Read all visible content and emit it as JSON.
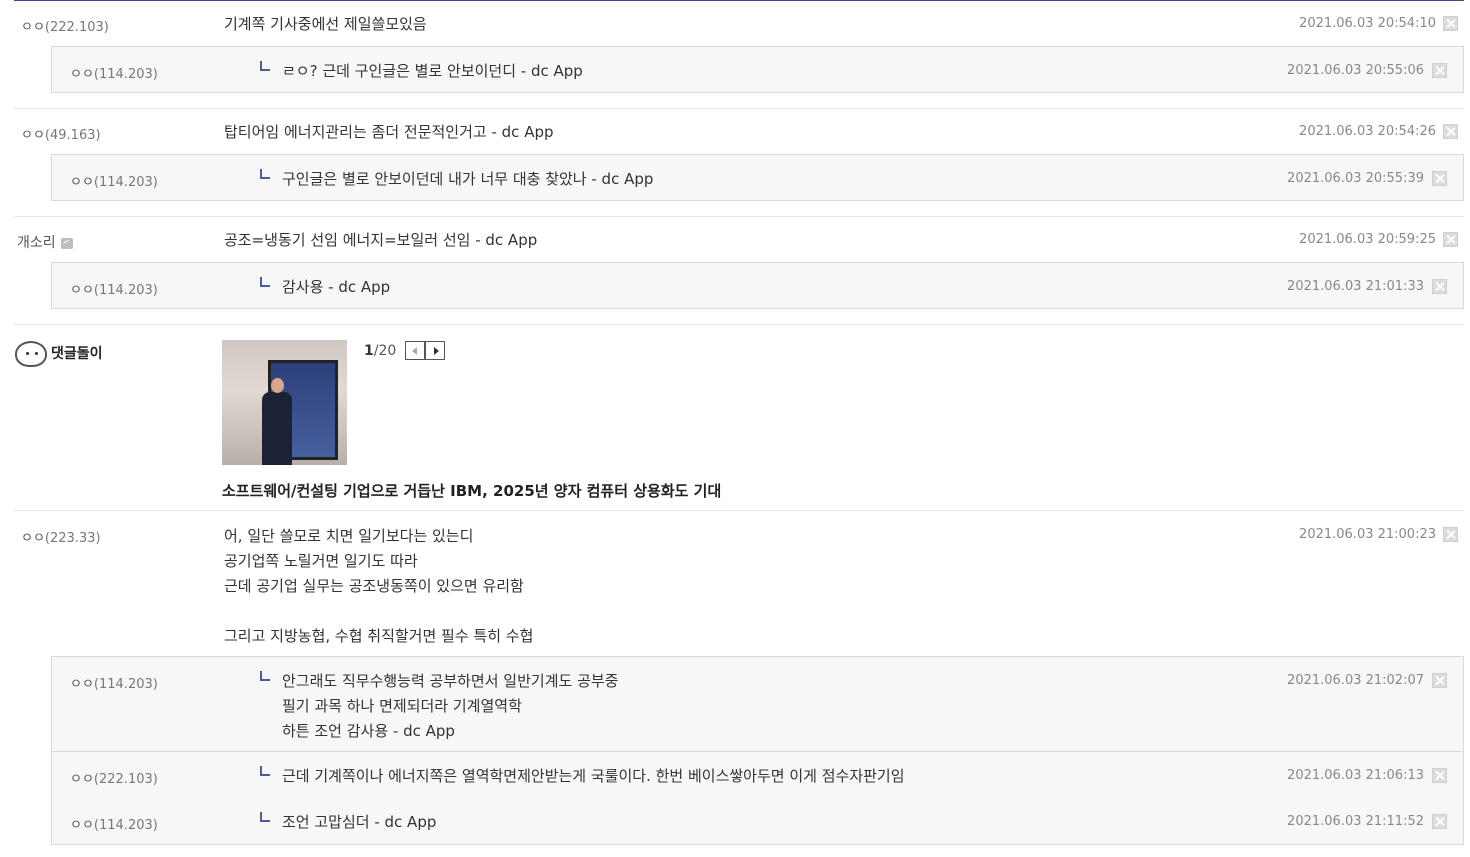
{
  "comments": [
    {
      "nick": "ㅇㅇ",
      "ip": "(222.103)",
      "text": "기계쪽 기사중에선 제일쓸모있음",
      "date": "2021.06.03 20:54:10",
      "replies": [
        {
          "nick": "ㅇㅇ",
          "ip": "(114.203)",
          "text": "ㄹㅇ? 근데 구인글은 별로 안보이던디 - dc App",
          "date": "2021.06.03 20:55:06"
        }
      ]
    },
    {
      "nick": "ㅇㅇ",
      "ip": "(49.163)",
      "text": "탑티어임 에너지관리는 좀더 전문적인거고 - dc App",
      "date": "2021.06.03 20:54:26",
      "replies": [
        {
          "nick": "ㅇㅇ",
          "ip": "(114.203)",
          "text": "구인글은 별로 안보이던데 내가 너무 대충 찾았나 - dc App",
          "date": "2021.06.03 20:55:39"
        }
      ]
    },
    {
      "nick": "개소리",
      "text": "공조=냉동기 선임 에너지=보일러 선임 - dc App",
      "date": "2021.06.03 20:59:25",
      "replies": [
        {
          "nick": "ㅇㅇ",
          "ip": "(114.203)",
          "text": "감사용 - dc App",
          "date": "2021.06.03 21:01:33"
        }
      ]
    },
    {
      "nick": "ㅇㅇ",
      "ip": "(223.33)",
      "lines": [
        "어, 일단 쓸모로 치면 일기보다는 있는디",
        "공기업쪽 노릴거면 일기도 따라",
        "근데 공기업 실무는 공조냉동쪽이 있으면 유리함",
        "",
        "그리고 지방농협, 수협 취직할거면 필수 특히 수협"
      ],
      "date": "2021.06.03 21:00:23",
      "replies": [
        {
          "nick": "ㅇㅇ",
          "ip": "(114.203)",
          "lines": [
            "안그래도 직무수행능력 공부하면서 일반기계도 공부중",
            "필기 과목 하나 면제되더라 기계열역학",
            "하튼 조언 감사용 - dc App"
          ],
          "date": "2021.06.03 21:02:07"
        },
        {
          "nick": "ㅇㅇ",
          "ip": "(222.103)",
          "text": "근데 기계쪽이나 에너지쪽은 열역학면제안받는게 국룰이다. 한번 베이스쌓아두면 이게 점수자판기임",
          "date": "2021.06.03 21:06:13"
        },
        {
          "nick": "ㅇㅇ",
          "ip": "(114.203)",
          "text": "조언 고맙심더 - dc App",
          "date": "2021.06.03 21:11:52"
        }
      ]
    }
  ],
  "bot": {
    "name": "댓글돌이",
    "page_current": "1",
    "page_total": "/20",
    "headline": "소프트웨어/컨설팅 기업으로 거듭난 IBM, 2025년 양자 컴퓨터 상용화도 기대"
  },
  "icons": {
    "delete": "close-x-icon",
    "reply": "reply-arrow-icon",
    "gallog": "gallog-icon",
    "bot_avatar": "dolphin-bot-icon",
    "prev": "chevron-left-icon",
    "next": "chevron-right-icon"
  }
}
